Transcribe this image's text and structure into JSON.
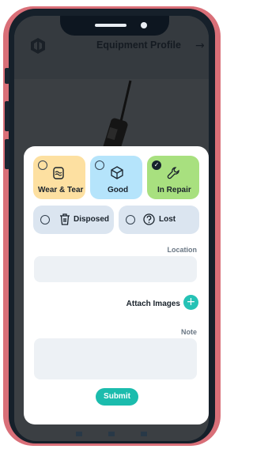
{
  "header": {
    "title": "Equipment Profile",
    "logo_icon": "hexagon-logo-icon",
    "action_icon": "arrow-right-icon"
  },
  "status_options": [
    {
      "label": "Wear & Tear",
      "icon": "wear-icon",
      "selected": false,
      "color": "#fde0a1"
    },
    {
      "label": "Good",
      "icon": "cube-icon",
      "selected": false,
      "color": "#b5e4fb"
    },
    {
      "label": "In Repair",
      "icon": "wrench-icon",
      "selected": true,
      "color": "#a8e07f"
    },
    {
      "label": "Disposed",
      "icon": "trash-icon",
      "selected": false,
      "color": "#dbe5f0"
    },
    {
      "label": "Lost",
      "icon": "question-icon",
      "selected": false,
      "color": "#dbe5f0"
    }
  ],
  "form": {
    "location_label": "Location",
    "location_value": "",
    "attach_label": "Attach Images",
    "attach_button": "+",
    "note_label": "Note",
    "note_value": "",
    "submit_label": "Submit"
  },
  "colors": {
    "accent": "#1bbcad",
    "frame": "#d96f78"
  }
}
